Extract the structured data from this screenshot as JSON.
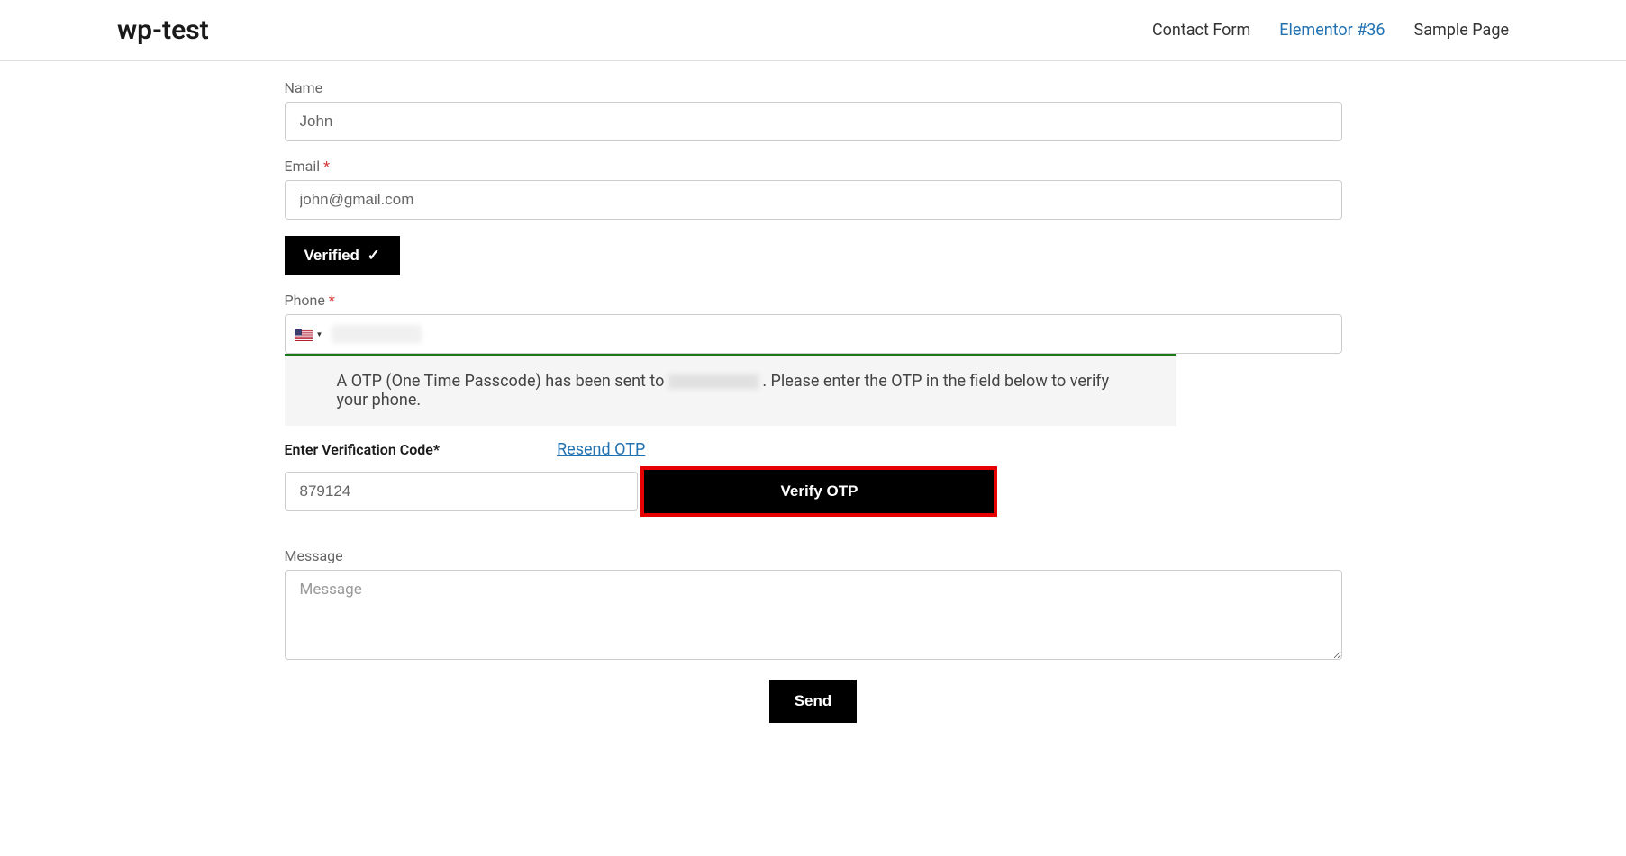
{
  "header": {
    "site_title": "wp-test",
    "nav": {
      "contact_form": "Contact Form",
      "elementor": "Elementor #36",
      "sample_page": "Sample Page"
    }
  },
  "form": {
    "name": {
      "label": "Name",
      "value": "John"
    },
    "email": {
      "label": "Email",
      "required_mark": "*",
      "value": "john@gmail.com"
    },
    "verified_button": "Verified",
    "verified_check": "✓",
    "phone": {
      "label": "Phone",
      "required_mark": "*"
    },
    "otp_notice": {
      "part1": "A OTP (One Time Passcode) has been sent to ",
      "part2": ". Please enter the OTP in the field below to verify your phone."
    },
    "verification_label": "Enter Verification Code*",
    "resend_link": "Resend OTP",
    "code_value": "879124",
    "verify_button": "Verify OTP",
    "message": {
      "label": "Message",
      "placeholder": "Message"
    },
    "send_button": "Send"
  }
}
